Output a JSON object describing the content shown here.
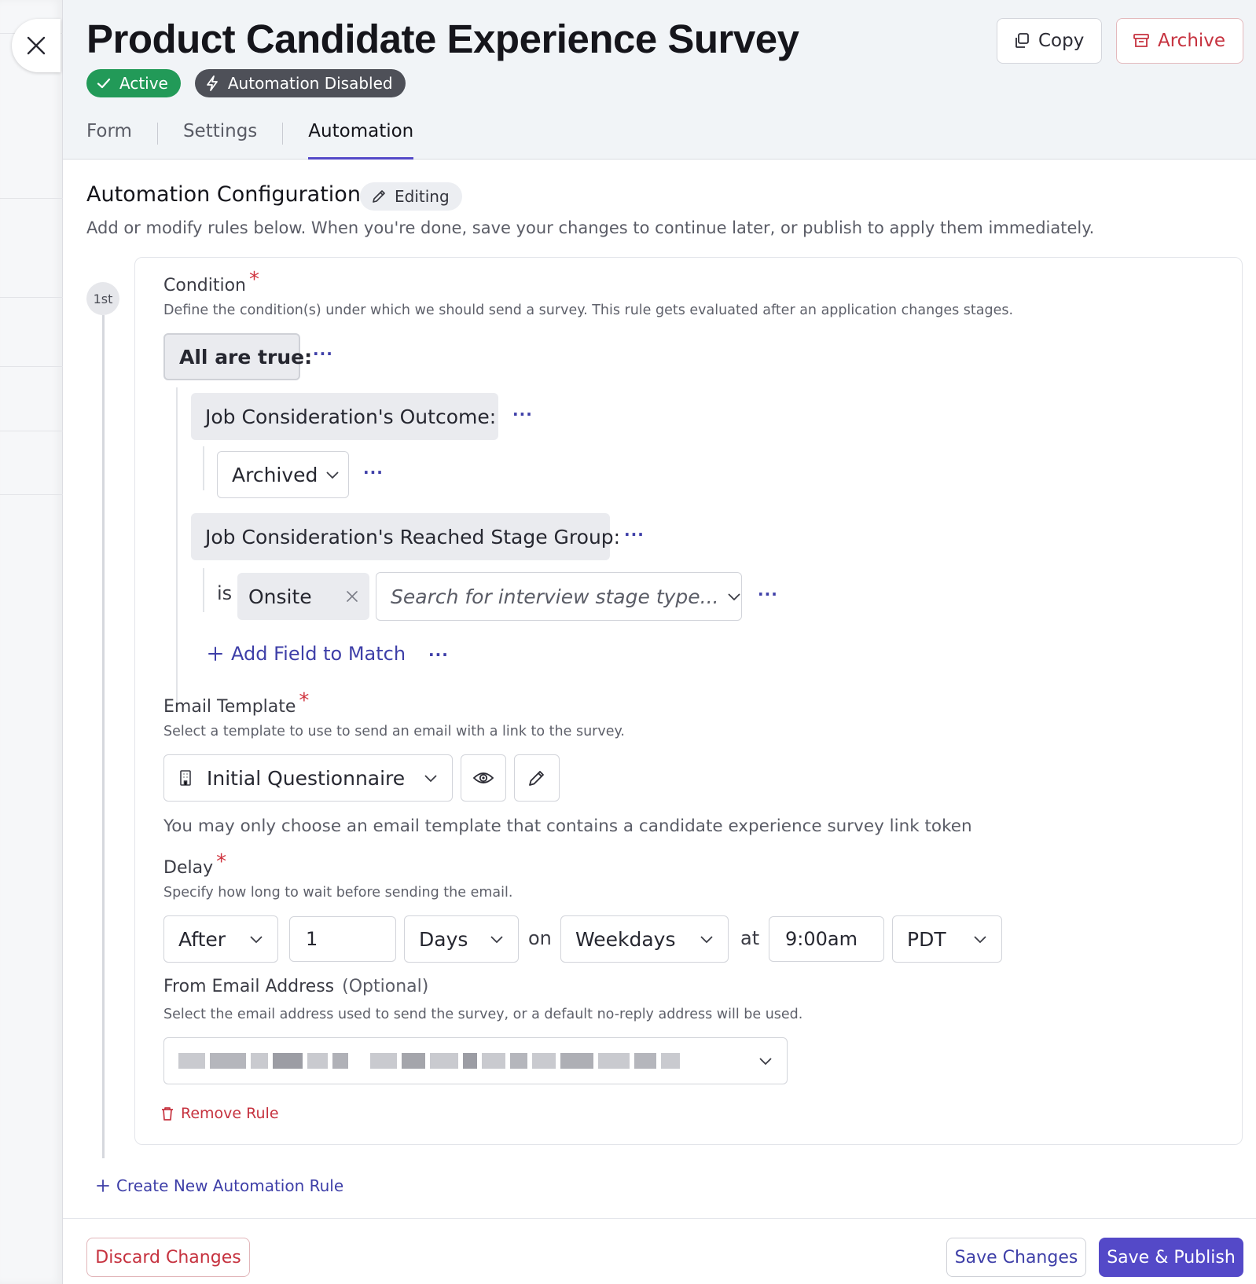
{
  "header": {
    "title": "Product Candidate Experience Survey",
    "badges": {
      "active": "Active",
      "automation": "Automation Disabled"
    },
    "copy_label": "Copy",
    "archive_label": "Archive"
  },
  "tabs": [
    {
      "label": "Form",
      "active": false
    },
    {
      "label": "Settings",
      "active": false
    },
    {
      "label": "Automation",
      "active": true
    }
  ],
  "section": {
    "title": "Automation Configuration",
    "status_chip": "Editing",
    "description": "Add or modify rules below. When you're done, save your changes to continue later, or publish to apply them immediately."
  },
  "rule": {
    "index_label": "1st",
    "condition": {
      "label": "Condition",
      "required_mark": "*",
      "help": "Define the condition(s) under which we should send a survey. This rule gets evaluated after an application changes stages.",
      "group_label": "All are true:",
      "field1": {
        "label": "Job Consideration's Outcome:",
        "value": "Archived"
      },
      "field2": {
        "label": "Job Consideration's Reached Stage Group:",
        "operator": "is",
        "selected_tag": "Onsite",
        "search_placeholder": "Search for interview stage type..."
      },
      "add_field_label": "Add Field to Match",
      "more_glyph": "···"
    },
    "email_template": {
      "label": "Email Template",
      "required_mark": "*",
      "help": "Select a template to use to send an email with a link to the survey.",
      "value": "Initial Questionnaire",
      "note": "You may only choose an email template that contains a candidate experience survey link token"
    },
    "delay": {
      "label": "Delay",
      "required_mark": "*",
      "help": "Specify how long to wait before sending the email.",
      "mode": "After",
      "amount": "1",
      "unit": "Days",
      "on_label": "on",
      "days": "Weekdays",
      "at_label": "at",
      "time": "9:00am",
      "timezone": "PDT"
    },
    "from_email": {
      "label": "From Email Address",
      "optional": "(Optional)",
      "help": "Select the email address used to send the survey, or a default no-reply address will be used."
    },
    "remove_label": "Remove Rule"
  },
  "create_rule_label": "Create New Automation Rule",
  "footer": {
    "discard_label": "Discard Changes",
    "save_label": "Save Changes",
    "publish_label": "Save & Publish"
  },
  "colors": {
    "accent": "#5449c8",
    "active_green": "#229a58",
    "danger": "#c6323f",
    "link": "#3e3fa8"
  }
}
